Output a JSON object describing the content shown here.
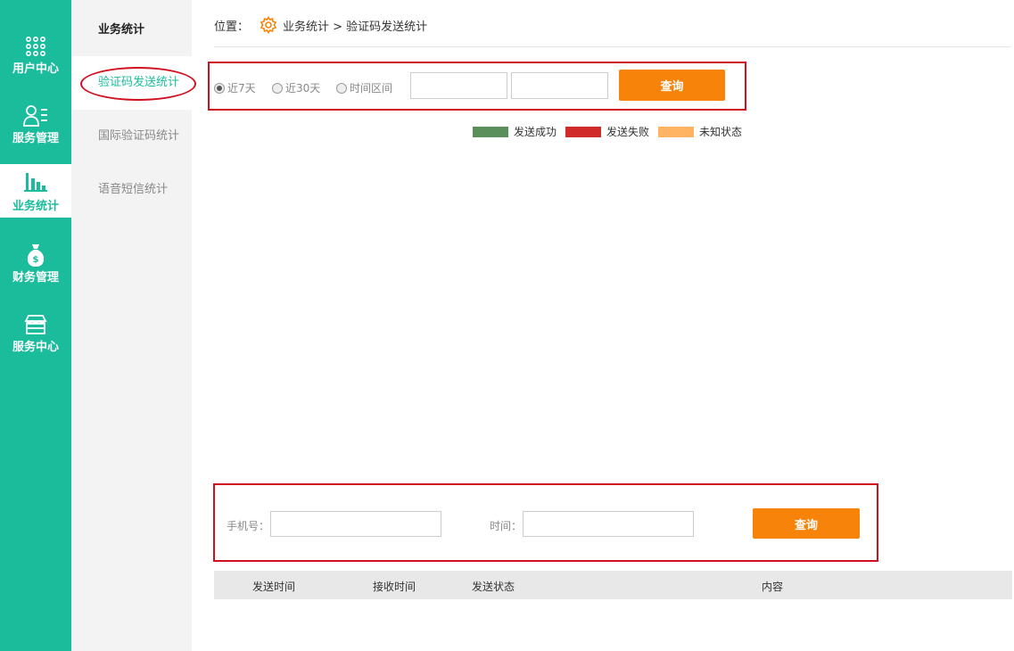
{
  "nav": {
    "items": [
      {
        "label": "用户中心",
        "icon": "dots-grid-icon"
      },
      {
        "label": "服务管理",
        "icon": "user-list-icon"
      },
      {
        "label": "业务统计",
        "icon": "bar-chart-icon"
      },
      {
        "label": "财务管理",
        "icon": "money-bag-icon"
      },
      {
        "label": "服务中心",
        "icon": "store-icon"
      }
    ]
  },
  "submenu": {
    "title": "业务统计",
    "items": [
      {
        "label": "验证码发送统计"
      },
      {
        "label": "国际验证码统计"
      },
      {
        "label": "语音短信统计"
      }
    ]
  },
  "breadcrumb": {
    "prefix": "位置：",
    "icon": "gear-icon",
    "path": "业务统计 > 验证码发送统计"
  },
  "filter": {
    "radio_7": "近7天",
    "radio_30": "近30天",
    "radio_range": "时间区间",
    "start_value": "",
    "end_value": "",
    "query_label": "查询"
  },
  "legend": {
    "success": "发送成功",
    "fail": "发送失败",
    "unknown": "未知状态",
    "colors": {
      "success": "#5a8e5a",
      "fail": "#d02a2a",
      "unknown": "#ffb464"
    }
  },
  "search": {
    "phone_label": "手机号：",
    "time_label": "时间：",
    "phone_value": "",
    "time_value": "",
    "query_label": "查询"
  },
  "table": {
    "headers": [
      "发送时间",
      "接收时间",
      "发送状态",
      "内容"
    ]
  },
  "colors": {
    "accent": "#1abc9c",
    "button": "#f7830b",
    "highlight": "#d0101e"
  }
}
